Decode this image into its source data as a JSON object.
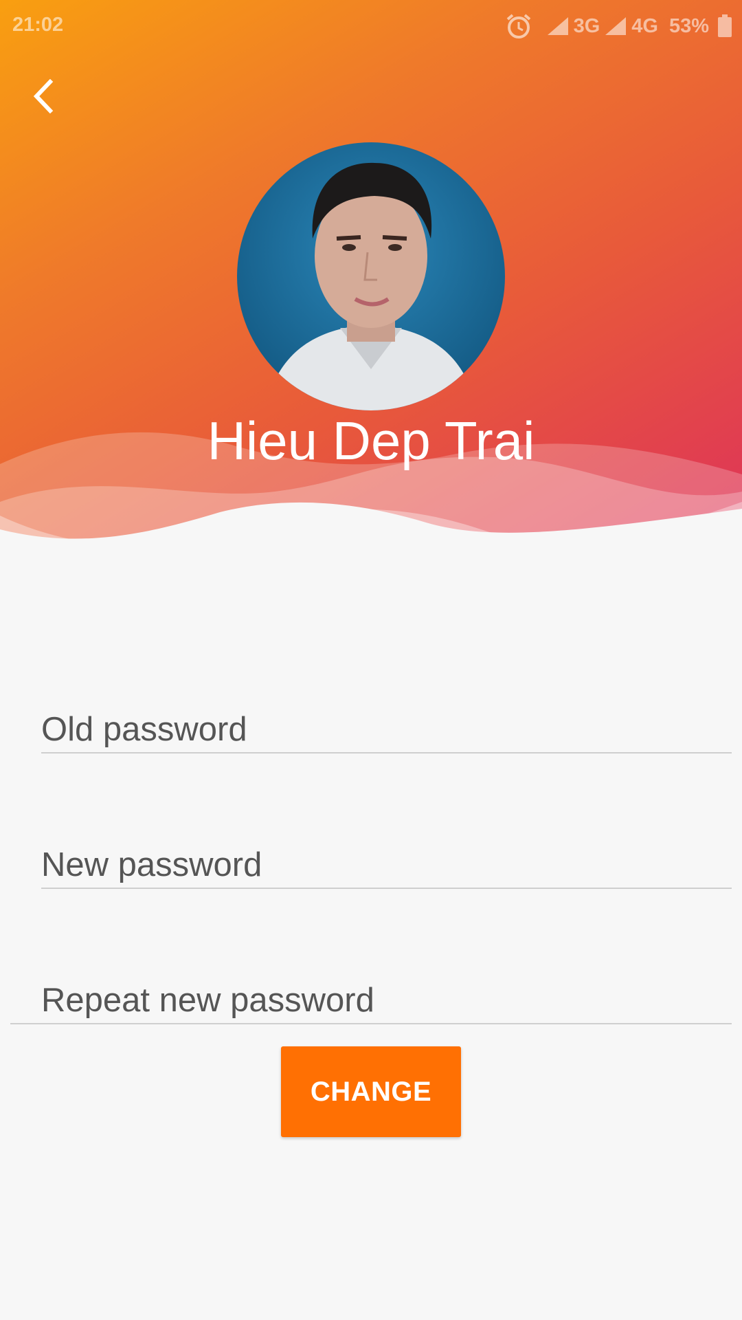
{
  "status_bar": {
    "time": "21:02",
    "network_1": "3G",
    "network_2": "4G",
    "battery": "53%"
  },
  "profile": {
    "name": "Hieu Dep Trai"
  },
  "form": {
    "old_password_placeholder": "Old password",
    "new_password_placeholder": "New password",
    "repeat_password_placeholder": "Repeat new password",
    "old_password_value": "",
    "new_password_value": "",
    "repeat_password_value": ""
  },
  "actions": {
    "change_label": "CHANGE"
  },
  "colors": {
    "accent": "#ff7003",
    "gradient_start": "#f99f10",
    "gradient_end": "#dd2f5c",
    "background": "#f7f7f7"
  },
  "icons": {
    "back": "chevron-left-icon",
    "alarm": "alarm-icon",
    "signal": "signal-icon",
    "battery": "battery-icon"
  }
}
